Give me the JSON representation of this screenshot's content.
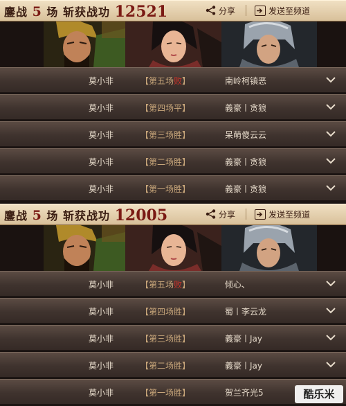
{
  "panels": [
    {
      "title_prefix": "鏖战",
      "count": "5",
      "count_unit": "场",
      "merit_label": "斩获战功",
      "merit": "12521",
      "share_label": "分享",
      "send_label": "发送至频道",
      "rows": [
        {
          "name": "莫小非",
          "round_prefix": "【第五场",
          "result": "败",
          "round_suffix": "】",
          "opponent": "南岭柯镇恶",
          "lose": true
        },
        {
          "name": "莫小非",
          "round_prefix": "【第四场",
          "result": "平",
          "round_suffix": "】",
          "opponent": "義豪丨贪狼",
          "lose": false
        },
        {
          "name": "莫小非",
          "round_prefix": "【第三场",
          "result": "胜",
          "round_suffix": "】",
          "opponent": "呆萌傻云云",
          "lose": false
        },
        {
          "name": "莫小非",
          "round_prefix": "【第二场",
          "result": "胜",
          "round_suffix": "】",
          "opponent": "義豪丨贪狼",
          "lose": false
        },
        {
          "name": "莫小非",
          "round_prefix": "【第一场",
          "result": "胜",
          "round_suffix": "】",
          "opponent": "義豪丨贪狼",
          "lose": false
        }
      ]
    },
    {
      "title_prefix": "鏖战",
      "count": "5",
      "count_unit": "场",
      "merit_label": "斩获战功",
      "merit": "12005",
      "share_label": "分享",
      "send_label": "发送至频道",
      "rows": [
        {
          "name": "莫小非",
          "round_prefix": "【第五场",
          "result": "败",
          "round_suffix": "】",
          "opponent": "倾心、",
          "lose": true
        },
        {
          "name": "莫小非",
          "round_prefix": "【第四场",
          "result": "胜",
          "round_suffix": "】",
          "opponent": "蜀丨李云龙",
          "lose": false
        },
        {
          "name": "莫小非",
          "round_prefix": "【第三场",
          "result": "胜",
          "round_suffix": "】",
          "opponent": "義豪丨Jay",
          "lose": false
        },
        {
          "name": "莫小非",
          "round_prefix": "【第二场",
          "result": "胜",
          "round_suffix": "】",
          "opponent": "義豪丨Jay",
          "lose": false
        },
        {
          "name": "莫小非",
          "round_prefix": "【第一场",
          "result": "胜",
          "round_suffix": "】",
          "opponent": "贺兰齐光5",
          "lose": false
        }
      ]
    }
  ],
  "watermark": "酷乐米",
  "colors": {
    "lose": "#c8332a",
    "accent": "#7a1a14"
  }
}
